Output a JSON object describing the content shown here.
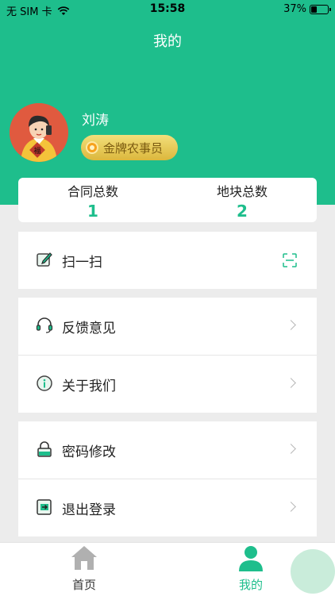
{
  "status_bar": {
    "carrier": "无 SIM 卡",
    "time": "15:58",
    "battery": "37%",
    "battery_level": 0.37
  },
  "header": {
    "title": "我的"
  },
  "profile": {
    "name": "刘涛",
    "badge": "金牌农事员"
  },
  "stats": [
    {
      "label": "合同总数",
      "value": "1"
    },
    {
      "label": "地块总数",
      "value": "2"
    }
  ],
  "menu": {
    "scan": "扫一扫",
    "feedback": "反馈意见",
    "about": "关于我们",
    "password": "密码修改",
    "logout": "退出登录"
  },
  "tabs": [
    {
      "label": "首页"
    },
    {
      "label": "我的"
    }
  ],
  "colors": {
    "accent": "#1ebe8c",
    "background": "#ececec",
    "badge_gold": "#dcb73c"
  }
}
